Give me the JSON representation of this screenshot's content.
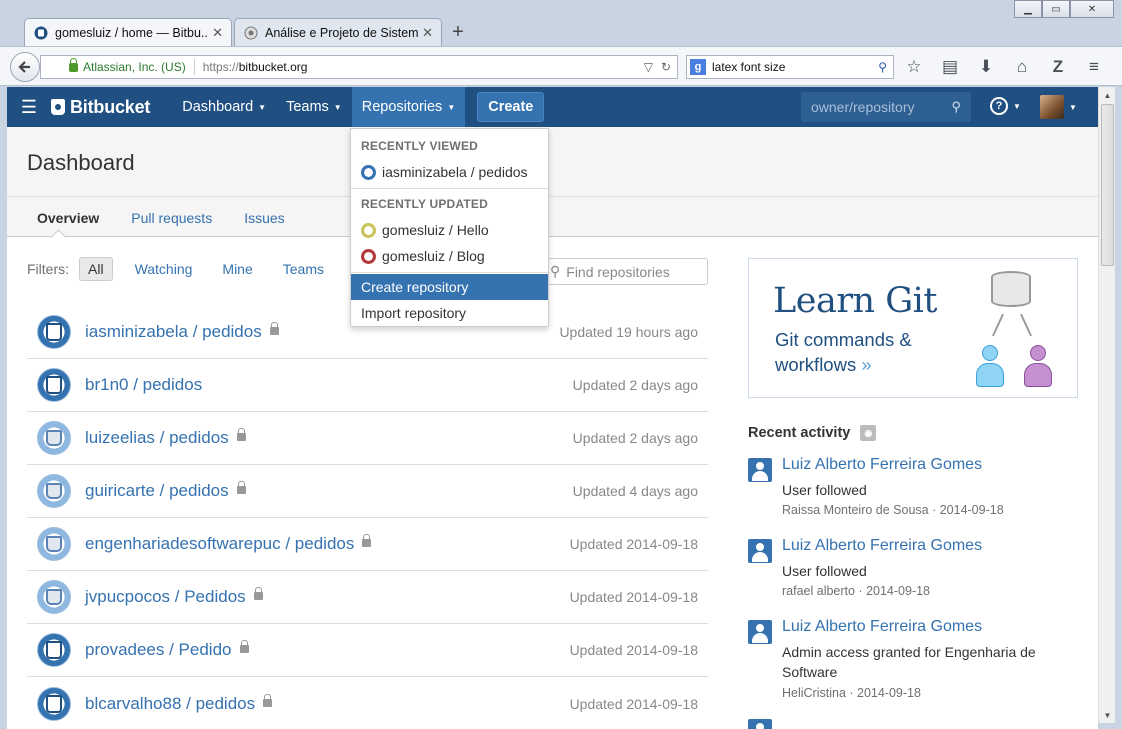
{
  "browser": {
    "tabs": [
      {
        "title": "gomesluiz / home — Bitbu...",
        "active": true
      },
      {
        "title": "Análise e Projeto de Sistem...",
        "active": false
      }
    ],
    "identity": "Atlassian, Inc. (US)",
    "url_protocol": "https://",
    "url_host": "bitbucket.org",
    "search_value": "latex font size"
  },
  "header": {
    "logo": "Bitbucket",
    "nav": [
      {
        "label": "Dashboard"
      },
      {
        "label": "Teams"
      },
      {
        "label": "Repositories"
      }
    ],
    "create_label": "Create",
    "search_placeholder": "owner/repository"
  },
  "dashboard": {
    "title": "Dashboard",
    "tabs": [
      {
        "label": "Overview"
      },
      {
        "label": "Pull requests"
      },
      {
        "label": "Issues"
      }
    ],
    "filters_label": "Filters:",
    "filters": [
      {
        "label": "All"
      },
      {
        "label": "Watching"
      },
      {
        "label": "Mine"
      },
      {
        "label": "Teams"
      }
    ],
    "find_placeholder": "Find repositories"
  },
  "repos": [
    {
      "name": "iasminizabela / pedidos",
      "updated": "Updated 19 hours ago",
      "private": true,
      "avatar": "bucket"
    },
    {
      "name": "br1n0 / pedidos",
      "updated": "Updated 2 days ago",
      "private": false,
      "avatar": "bucket"
    },
    {
      "name": "luizeelias / pedidos",
      "updated": "Updated 2 days ago",
      "private": true,
      "avatar": "java"
    },
    {
      "name": "guiricarte / pedidos",
      "updated": "Updated 4 days ago",
      "private": true,
      "avatar": "java"
    },
    {
      "name": "engenhariadesoftwarepuc / pedidos",
      "updated": "Updated 2014-09-18",
      "private": true,
      "avatar": "java"
    },
    {
      "name": "jvpucpocos / Pedidos",
      "updated": "Updated 2014-09-18",
      "private": true,
      "avatar": "java"
    },
    {
      "name": "provadees / Pedido",
      "updated": "Updated 2014-09-18",
      "private": true,
      "avatar": "bucket"
    },
    {
      "name": "blcarvalho88 / pedidos",
      "updated": "Updated 2014-09-18",
      "private": true,
      "avatar": "bucket"
    }
  ],
  "learn_git": {
    "title": "Learn Git",
    "subtitle": "Git commands & workflows",
    "arrow": "»"
  },
  "recent_activity": {
    "title": "Recent activity",
    "items": [
      {
        "user": "Luiz Alberto Ferreira Gomes",
        "text": "User followed",
        "meta": "Raissa Monteiro de Sousa · 2014-09-18"
      },
      {
        "user": "Luiz Alberto Ferreira Gomes",
        "text": "User followed",
        "meta": "rafael alberto · 2014-09-18"
      },
      {
        "user": "Luiz Alberto Ferreira Gomes",
        "text": "Admin access granted for Engenharia de Software",
        "meta": "HeliCristina · 2014-09-18"
      }
    ]
  },
  "repo_dropdown": {
    "recently_viewed_label": "RECENTLY VIEWED",
    "recently_viewed": [
      {
        "name": "iasminizabela / pedidos"
      }
    ],
    "recently_updated_label": "RECENTLY UPDATED",
    "recently_updated": [
      {
        "name": "gomesluiz / Hello"
      },
      {
        "name": "gomesluiz / Blog"
      }
    ],
    "create_label": "Create repository",
    "import_label": "Import repository"
  },
  "colors": {
    "header_bg": "#205081",
    "accent": "#3572b0"
  }
}
